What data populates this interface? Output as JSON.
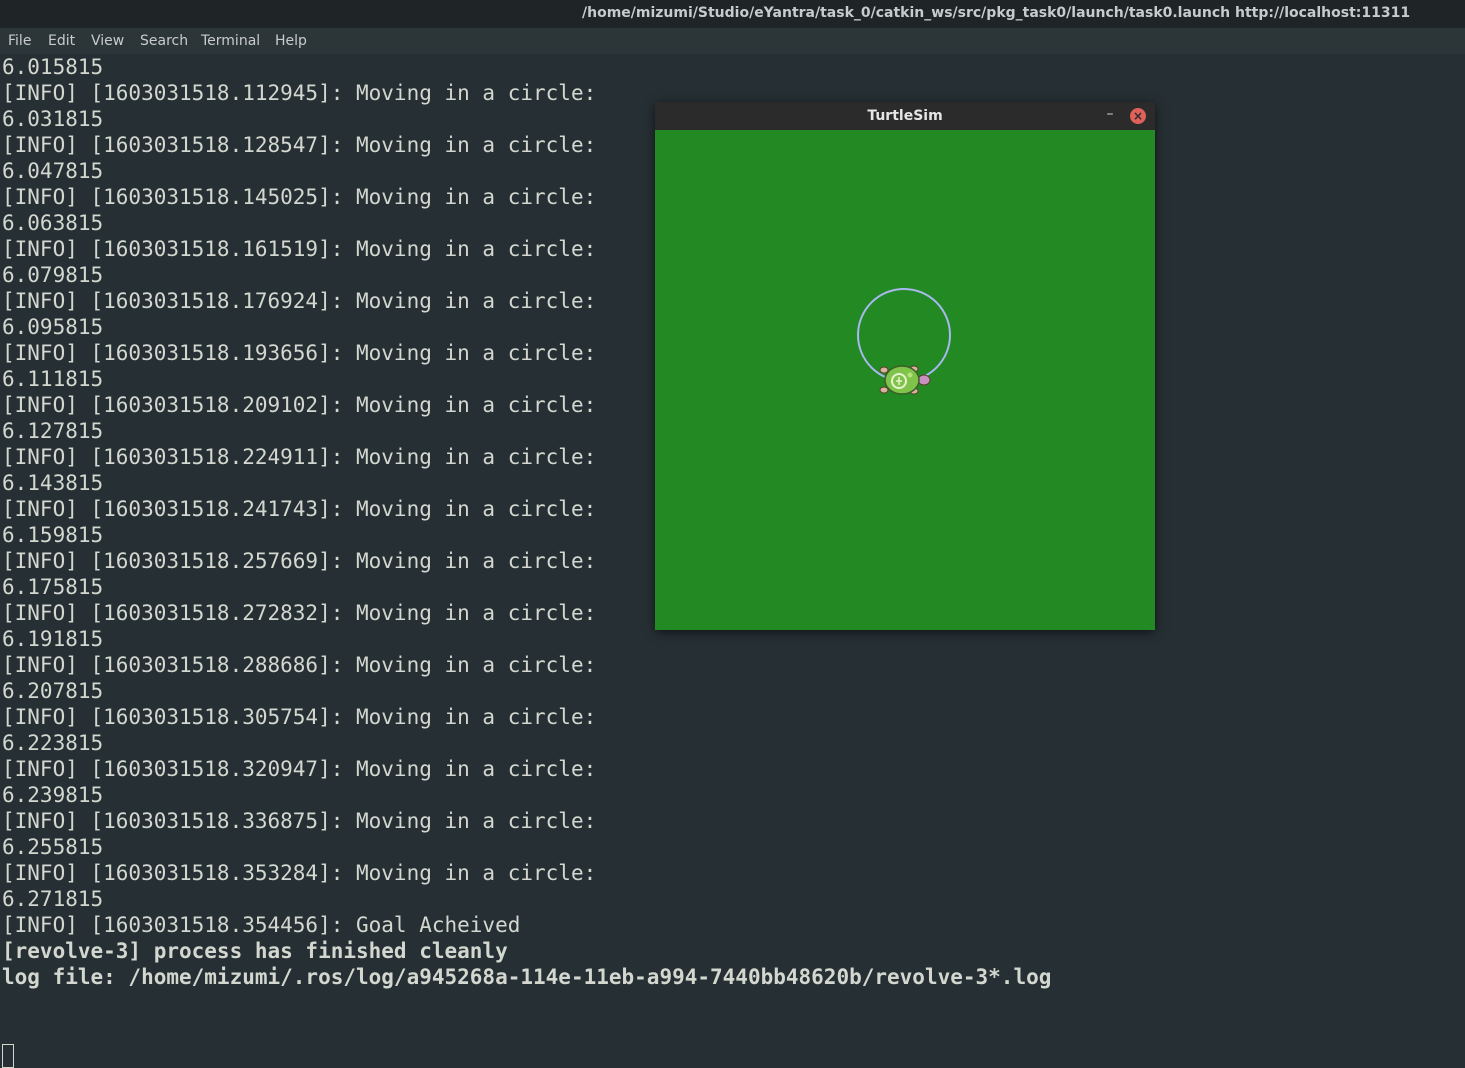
{
  "window": {
    "title": "/home/mizumi/Studio/eYantra/task_0/catkin_ws/src/pkg_task0/launch/task0.launch http://localhost:11311"
  },
  "menu": [
    "File",
    "Edit",
    "View",
    "Search",
    "Terminal",
    "Help"
  ],
  "terminal": {
    "lines": [
      "6.015815",
      "[INFO] [1603031518.112945]: Moving in a circle:",
      "6.031815",
      "[INFO] [1603031518.128547]: Moving in a circle:",
      "6.047815",
      "[INFO] [1603031518.145025]: Moving in a circle:",
      "6.063815",
      "[INFO] [1603031518.161519]: Moving in a circle:",
      "6.079815",
      "[INFO] [1603031518.176924]: Moving in a circle:",
      "6.095815",
      "[INFO] [1603031518.193656]: Moving in a circle:",
      "6.111815",
      "[INFO] [1603031518.209102]: Moving in a circle:",
      "6.127815",
      "[INFO] [1603031518.224911]: Moving in a circle:",
      "6.143815",
      "[INFO] [1603031518.241743]: Moving in a circle:",
      "6.159815",
      "[INFO] [1603031518.257669]: Moving in a circle:",
      "6.175815",
      "[INFO] [1603031518.272832]: Moving in a circle:",
      "6.191815",
      "[INFO] [1603031518.288686]: Moving in a circle:",
      "6.207815",
      "[INFO] [1603031518.305754]: Moving in a circle:",
      "6.223815",
      "[INFO] [1603031518.320947]: Moving in a circle:",
      "6.239815",
      "[INFO] [1603031518.336875]: Moving in a circle:",
      "6.255815",
      "[INFO] [1603031518.353284]: Moving in a circle:",
      "6.271815",
      "[INFO] [1603031518.354456]: Goal Acheived",
      "[revolve-3] process has finished cleanly",
      "log file: /home/mizumi/.ros/log/a945268a-114e-11eb-a994-7440bb48620b/revolve-3*.log"
    ],
    "bold_from_index": 34
  },
  "turtlesim": {
    "title": "TurtleSim",
    "minimize_glyph": "–",
    "close_glyph": "×",
    "background_color": "#238a23",
    "path_color": "#a9b8f0"
  }
}
